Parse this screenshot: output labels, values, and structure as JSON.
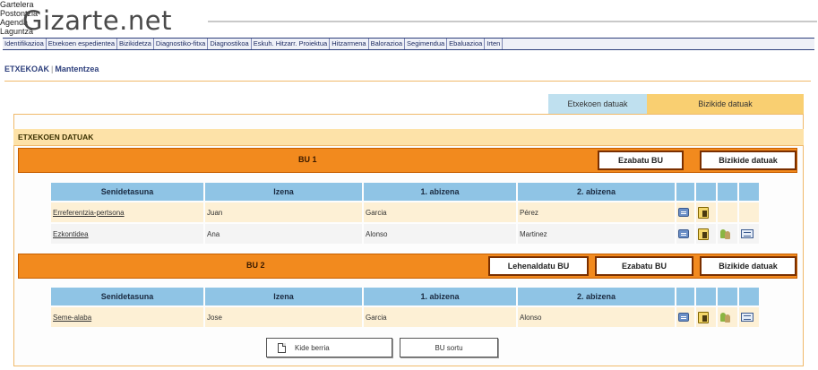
{
  "app": {
    "logo": "Gizarte.net",
    "top_nav": [
      "Gartelera",
      "Postontzia",
      "Agenda",
      "Laguntza"
    ],
    "tabs": [
      "Identifikazioa",
      "Etxekoen espedientea",
      "Bizikidetza",
      "Diagnostiko-fitxa",
      "Diagnostikoa",
      "Eskuh. Hitzarr. Proiektua",
      "Hitzarmena",
      "Balorazioa",
      "Segimendua",
      "Ebaluazioa",
      "Irten"
    ]
  },
  "breadcrumb": {
    "first": "ETXEKOAK",
    "separator": "|",
    "second": "Mantentzea"
  },
  "side_tabs": [
    "Etxekoen datuak",
    "Bizikide datuak"
  ],
  "panel": {
    "title": "ETXEKOEN DATUAK",
    "units": [
      {
        "title": "BU 1",
        "buttons": [
          "Ezabatu BU",
          "Bizikide datuak"
        ],
        "headers": [
          "Senidetasuna",
          "Izena",
          "1. abizena",
          "2. abizena"
        ],
        "rows": [
          {
            "relation": "Erreferentzia-pertsona",
            "name": "Juan",
            "surname1": "Garcia",
            "surname2": "Pérez"
          },
          {
            "relation": "Ezkontidea",
            "name": "Ana",
            "surname1": "Alonso",
            "surname2": "Martinez"
          }
        ]
      },
      {
        "title": "BU 2",
        "buttons": [
          "Lehenaldatu BU",
          "Ezabatu BU",
          "Bizikide datuak"
        ],
        "headers": [
          "Senidetasuna",
          "Izena",
          "1. abizena",
          "2. abizena"
        ],
        "rows": [
          {
            "relation": "Seme-alaba",
            "name": "Jose",
            "surname1": "Garcia",
            "surname2": "Alonso"
          }
        ]
      }
    ],
    "bottom_buttons": [
      "Kide berria",
      "BU sortu"
    ]
  },
  "colors": {
    "nav": "#2d3f7c",
    "unit_bar": "#f28a1e",
    "table_header": "#8fc4e5",
    "panel_title": "#fde2a8"
  },
  "icons": [
    "edit-icon",
    "card-icon",
    "people-icon",
    "folder-icon"
  ]
}
